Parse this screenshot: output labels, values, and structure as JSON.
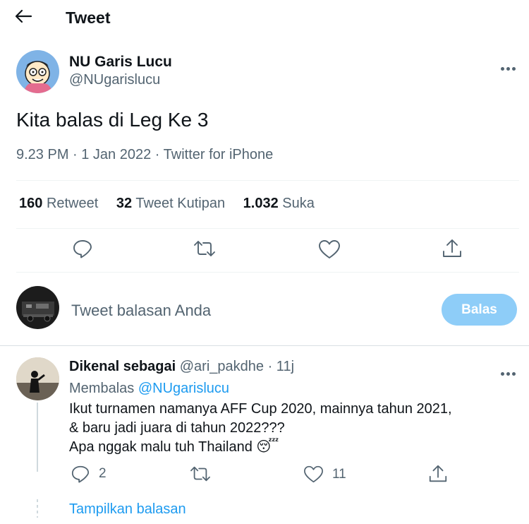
{
  "header": {
    "title": "Tweet"
  },
  "tweet": {
    "author_name": "NU Garis Lucu",
    "author_handle": "@NUgarislucu",
    "text": "Kita balas di Leg Ke 3",
    "meta": "9.23 PM · 1 Jan 2022 · Twitter for iPhone",
    "stats": {
      "retweets_count": "160",
      "retweets_label": "Retweet",
      "quotes_count": "32",
      "quotes_label": "Tweet Kutipan",
      "likes_count": "1.032",
      "likes_label": "Suka"
    }
  },
  "compose": {
    "placeholder": "Tweet balasan Anda",
    "button": "Balas"
  },
  "reply": {
    "author_name": "Dikenal sebagai",
    "author_handle": "@ari_pakdhe",
    "time": "· 11j",
    "replying_prefix": "Membalas",
    "replying_handle": "@NUgarislucu",
    "lines": [
      "Ikut turnamen namanya AFF Cup 2020, mainnya tahun 2021,",
      "& baru jadi juara di tahun 2022???",
      "Apa nggak malu tuh Thailand"
    ],
    "emoji": "😴",
    "reply_count": "2",
    "like_count": "11",
    "show_replies": "Tampilkan balasan"
  },
  "colors": {
    "accent": "#1d9bf0",
    "accent_disabled": "#8ecdf8",
    "muted": "#536471",
    "divider": "#eff3f4"
  },
  "icons": [
    "back-arrow-icon",
    "more-icon",
    "reply-icon",
    "retweet-icon",
    "like-icon",
    "share-icon",
    "sleeping-face-emoji"
  ]
}
